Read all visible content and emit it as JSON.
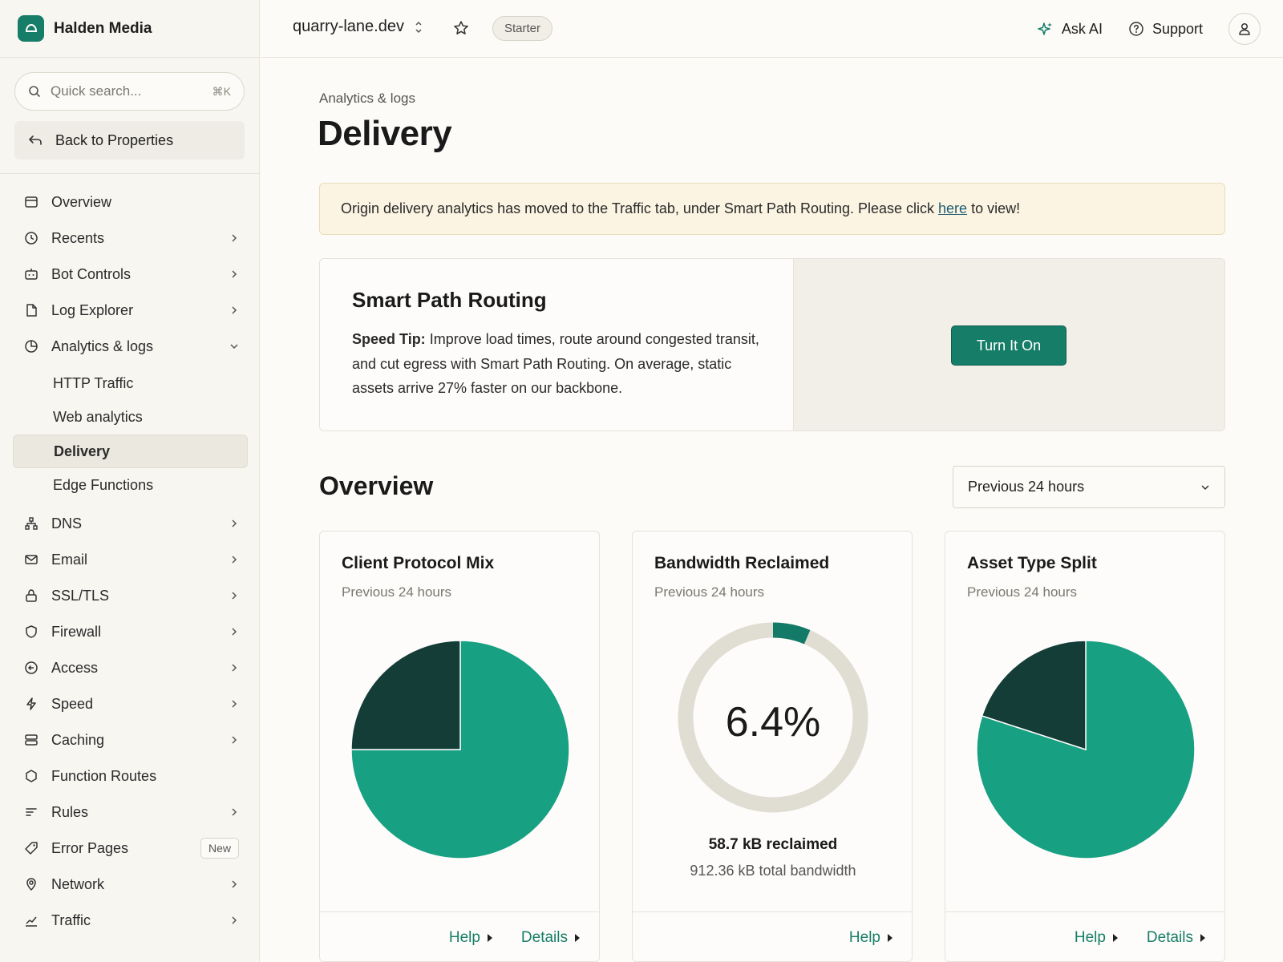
{
  "sidebar": {
    "brand": "Halden Media",
    "search_placeholder": "Quick search...",
    "search_shortcut": "⌘K",
    "back_label": "Back to Properties",
    "items": [
      {
        "label": "Overview",
        "icon": "overview-icon"
      },
      {
        "label": "Recents",
        "icon": "clock-icon"
      },
      {
        "label": "Bot Controls",
        "icon": "bot-icon"
      },
      {
        "label": "Log Explorer",
        "icon": "file-icon"
      },
      {
        "label": "Analytics & logs",
        "icon": "analytics-icon"
      },
      {
        "label": "DNS",
        "icon": "dns-icon"
      },
      {
        "label": "Email",
        "icon": "mail-icon"
      },
      {
        "label": "SSL/TLS",
        "icon": "lock-icon"
      },
      {
        "label": "Firewall",
        "icon": "shield-icon"
      },
      {
        "label": "Access",
        "icon": "access-icon"
      },
      {
        "label": "Speed",
        "icon": "bolt-icon"
      },
      {
        "label": "Caching",
        "icon": "server-icon"
      },
      {
        "label": "Function Routes",
        "icon": "hexagon-icon"
      },
      {
        "label": "Rules",
        "icon": "rules-icon"
      },
      {
        "label": "Error Pages",
        "icon": "tag-icon",
        "badge": "New"
      },
      {
        "label": "Network",
        "icon": "pin-icon"
      },
      {
        "label": "Traffic",
        "icon": "chart-icon"
      }
    ],
    "sub_items": [
      "HTTP Traffic",
      "Web analytics",
      "Delivery",
      "Edge Functions"
    ],
    "active_sub": "Delivery"
  },
  "topbar": {
    "domain": "quarry-lane.dev",
    "plan": "Starter",
    "ask_ai": "Ask AI",
    "support": "Support"
  },
  "main": {
    "breadcrumb": "Analytics & logs",
    "title": "Delivery",
    "notice": {
      "before": "Origin delivery analytics has moved to the Traffic tab, under Smart Path Routing. Please click",
      "link": "here",
      "after": "to view!"
    },
    "promo": {
      "title": "Smart Path Routing",
      "tip_label": "Speed Tip:",
      "tip_text": "Improve load times, route around congested transit, and cut egress with Smart Path Routing. On average, static assets arrive 27% faster on our backbone.",
      "button": "Turn It On"
    },
    "overview_title": "Overview",
    "period": "Previous 24 hours",
    "cards": [
      {
        "title": "Client Protocol Mix",
        "subtitle": "Previous 24 hours",
        "help": "Help",
        "details": "Details"
      },
      {
        "title": "Bandwidth Reclaimed",
        "subtitle": "Previous 24 hours",
        "value": "6.4%",
        "reclaimed": "58.7 kB reclaimed",
        "total": "912.36 kB total bandwidth",
        "help": "Help"
      },
      {
        "title": "Asset Type Split",
        "subtitle": "Previous 24 hours",
        "help": "Help",
        "details": "Details"
      }
    ]
  },
  "colors": {
    "accent": "#167e68",
    "chart_primary": "#18a083",
    "chart_dark": "#143d38",
    "donut_track": "#e0ddd3",
    "donut_fill": "#127a66",
    "notice_bg": "#fbf4e2"
  },
  "chart_data": [
    {
      "type": "pie",
      "title": "Client Protocol Mix",
      "values": [
        75,
        25
      ],
      "colors": [
        "#18a083",
        "#143d38"
      ]
    },
    {
      "type": "pie",
      "title": "Bandwidth Reclaimed",
      "values": [
        6.4,
        93.6
      ],
      "colors": [
        "#127a66",
        "#e0ddd3"
      ]
    },
    {
      "type": "pie",
      "title": "Asset Type Split",
      "values": [
        80,
        20
      ],
      "colors": [
        "#18a083",
        "#143d38"
      ]
    }
  ]
}
